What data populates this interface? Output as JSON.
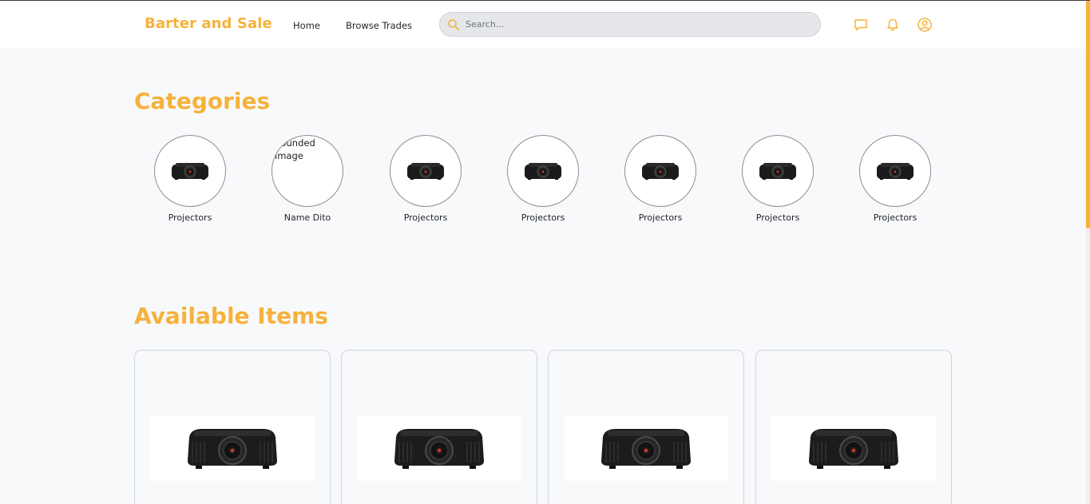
{
  "navbar": {
    "brand": "Barter and Sale",
    "links": {
      "home": "Home",
      "browse": "Browse Trades"
    },
    "search": {
      "placeholder": "Search..."
    },
    "icons": [
      "chat-icon",
      "bell-icon",
      "user-icon"
    ]
  },
  "categories": {
    "title": "Categories",
    "items": [
      {
        "label": "Projectors",
        "image": "projector"
      },
      {
        "label": "Name Dito",
        "image": "broken",
        "alt_text": "Rounded image"
      },
      {
        "label": "Projectors",
        "image": "projector"
      },
      {
        "label": "Projectors",
        "image": "projector"
      },
      {
        "label": "Projectors",
        "image": "projector"
      },
      {
        "label": "Projectors",
        "image": "projector"
      },
      {
        "label": "Projectors",
        "image": "projector"
      }
    ]
  },
  "available": {
    "title": "Available Items",
    "items": [
      {
        "image": "projector"
      },
      {
        "image": "projector"
      },
      {
        "image": "projector"
      },
      {
        "image": "projector"
      }
    ]
  },
  "colors": {
    "accent": "#f6b23c",
    "background": "#f8f9fb",
    "search_bg": "#e5e7eb"
  }
}
